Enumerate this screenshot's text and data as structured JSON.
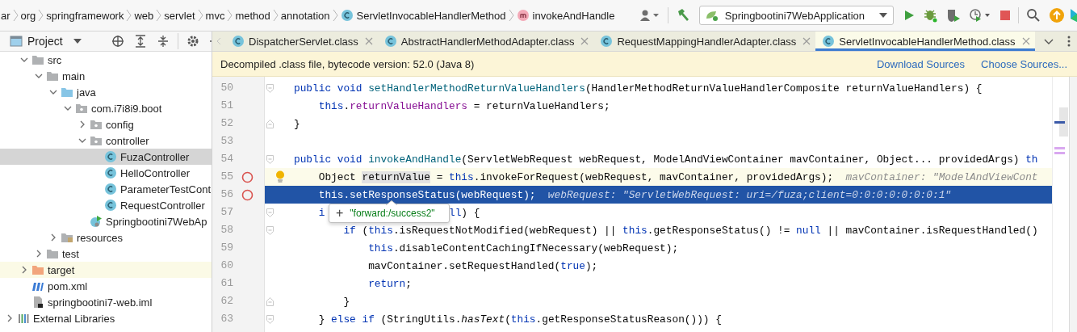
{
  "breadcrumbs": [
    {
      "text": "ar",
      "kind": "package"
    },
    {
      "text": "org",
      "kind": "package"
    },
    {
      "text": "springframework",
      "kind": "package"
    },
    {
      "text": "web",
      "kind": "package"
    },
    {
      "text": "servlet",
      "kind": "package"
    },
    {
      "text": "mvc",
      "kind": "package"
    },
    {
      "text": "method",
      "kind": "package"
    },
    {
      "text": "annotation",
      "kind": "package"
    },
    {
      "text": "ServletInvocableHandlerMethod",
      "kind": "class"
    },
    {
      "text": "invokeAndHandle",
      "kind": "method"
    }
  ],
  "run_configuration": "Springbootini7WebApplication",
  "project_panel": {
    "title": "Project"
  },
  "tree": [
    {
      "children": [
        {
          "label": "src",
          "kind": "folder",
          "expanded": true,
          "selected": false,
          "children": [
            {
              "label": "main",
              "kind": "folder",
              "expanded": true,
              "selected": false,
              "children": [
                {
                  "label": "java",
                  "kind": "source-folder",
                  "expanded": true,
                  "selected": false,
                  "children": [
                    {
                      "label": "com.i7i8i9.boot",
                      "kind": "package",
                      "expanded": true,
                      "selected": false,
                      "children": [
                        {
                          "label": "config",
                          "kind": "package",
                          "expanded": false,
                          "selected": false
                        },
                        {
                          "label": "controller",
                          "kind": "package",
                          "expanded": true,
                          "selected": false,
                          "children": [
                            {
                              "label": "FuzaController",
                              "kind": "class",
                              "selected": true
                            },
                            {
                              "label": "HelloController",
                              "kind": "class",
                              "selected": false
                            },
                            {
                              "label": "ParameterTestCont",
                              "kind": "class",
                              "selected": false
                            },
                            {
                              "label": "RequestController",
                              "kind": "class",
                              "selected": false
                            }
                          ]
                        },
                        {
                          "label": "Springbootini7WebAp",
                          "kind": "spring-app",
                          "selected": false
                        }
                      ]
                    }
                  ]
                },
                {
                  "label": "resources",
                  "kind": "resources-folder",
                  "expanded": false,
                  "selected": false
                }
              ]
            },
            {
              "label": "test",
              "kind": "folder",
              "expanded": false,
              "selected": false
            }
          ]
        },
        {
          "label": "target",
          "kind": "target-folder",
          "expanded": false,
          "selected": false
        },
        {
          "label": "pom.xml",
          "kind": "maven",
          "selected": false
        },
        {
          "label": "springbootini7-web.iml",
          "kind": "iml",
          "selected": false
        }
      ]
    },
    {
      "label": "External Libraries",
      "kind": "libraries",
      "expanded": false,
      "selected": false
    }
  ],
  "tabs": [
    {
      "label": "DispatcherServlet.class",
      "selected": false
    },
    {
      "label": "AbstractHandlerMethodAdapter.class",
      "selected": false
    },
    {
      "label": "RequestMappingHandlerAdapter.class",
      "selected": false
    },
    {
      "label": "ServletInvocableHandlerMethod.class",
      "selected": true
    }
  ],
  "banner": {
    "message": "Decompiled .class file, bytecode version: 52.0 (Java 8)",
    "links": [
      "Download Sources",
      "Choose Sources..."
    ]
  },
  "code_lines": [
    {
      "number": "50",
      "caret_line": false,
      "execution_point": false,
      "breakpoint": false,
      "intention": false,
      "fold_start": true,
      "fold_end": false,
      "tokens": [
        {
          "t": "public void ",
          "kind": "kw"
        },
        {
          "t": "setHandlerMethodReturnValueHandlers",
          "kind": "decl"
        },
        {
          "t": "(HandlerMethodReturnValueHandlerComposite returnValueHandlers) {",
          "kind": "text"
        }
      ]
    },
    {
      "number": "51",
      "caret_line": false,
      "execution_point": false,
      "breakpoint": false,
      "intention": false,
      "fold_start": false,
      "fold_end": false,
      "tokens": [
        {
          "t": "    this",
          "kind": "kw"
        },
        {
          "t": ".",
          "kind": "text"
        },
        {
          "t": "returnValueHandlers",
          "kind": "field"
        },
        {
          "t": " = returnValueHandlers;",
          "kind": "text"
        }
      ]
    },
    {
      "number": "52",
      "caret_line": false,
      "execution_point": false,
      "breakpoint": false,
      "intention": false,
      "fold_start": false,
      "fold_end": true,
      "tokens": [
        {
          "t": "}",
          "kind": "text"
        }
      ]
    },
    {
      "number": "53",
      "caret_line": false,
      "execution_point": false,
      "breakpoint": false,
      "intention": false,
      "fold_start": false,
      "fold_end": false
    },
    {
      "number": "54",
      "caret_line": false,
      "execution_point": false,
      "breakpoint": false,
      "intention": false,
      "fold_start": true,
      "fold_end": false,
      "tokens": [
        {
          "t": "public void ",
          "kind": "kw"
        },
        {
          "t": "invokeAndHandle",
          "kind": "decl"
        },
        {
          "t": "(ServletWebRequest webRequest, ModelAndViewContainer mavContainer, Object... providedArgs) ",
          "kind": "text"
        },
        {
          "t": "th",
          "kind": "kw"
        }
      ]
    },
    {
      "number": "55",
      "caret_line": true,
      "execution_point": false,
      "breakpoint": true,
      "intention": true,
      "fold_start": false,
      "fold_end": false,
      "tokens": [
        {
          "t": "    Object ",
          "kind": "text"
        },
        {
          "t": "returnValue",
          "kind": "ref"
        },
        {
          "t": " = ",
          "kind": "text"
        },
        {
          "t": "this",
          "kind": "kw"
        },
        {
          "t": ".invokeForRequest(webRequest, mavContainer, providedArgs);",
          "kind": "text"
        },
        {
          "t": "mavContainer: \"ModelAndViewCont",
          "kind": "hint"
        }
      ]
    },
    {
      "number": "56",
      "caret_line": false,
      "execution_point": true,
      "breakpoint": true,
      "intention": false,
      "fold_start": false,
      "fold_end": false,
      "tokens": [
        {
          "t": "    this.setResponseStatus(webRequest);",
          "kind": "text"
        },
        {
          "t": "webRequest: \"ServletWebRequest: uri=/fuza;client=0:0:0:0:0:0:0:1\"",
          "kind": "hint"
        }
      ]
    },
    {
      "number": "57",
      "caret_line": false,
      "execution_point": false,
      "breakpoint": false,
      "intention": false,
      "fold_start": true,
      "fold_end": false,
      "tokens": [
        {
          "t": "    i",
          "kind": "kw"
        },
        {
          "t": "ll",
          "kind": "kw",
          "after_popup": true
        },
        {
          "t": ") {",
          "kind": "text"
        }
      ]
    },
    {
      "number": "58",
      "caret_line": false,
      "execution_point": false,
      "breakpoint": false,
      "intention": false,
      "fold_start": true,
      "fold_end": false,
      "tokens": [
        {
          "t": "        if ",
          "kind": "kw"
        },
        {
          "t": "(",
          "kind": "text"
        },
        {
          "t": "this",
          "kind": "kw"
        },
        {
          "t": ".isRequestNotModified(webRequest) || ",
          "kind": "text"
        },
        {
          "t": "this",
          "kind": "kw"
        },
        {
          "t": ".getResponseStatus() != ",
          "kind": "text"
        },
        {
          "t": "null",
          "kind": "kw"
        },
        {
          "t": " || mavContainer.isRequestHandled()",
          "kind": "text"
        }
      ]
    },
    {
      "number": "59",
      "caret_line": false,
      "execution_point": false,
      "breakpoint": false,
      "intention": false,
      "fold_start": false,
      "fold_end": false,
      "tokens": [
        {
          "t": "            this",
          "kind": "kw"
        },
        {
          "t": ".disableContentCachingIfNecessary(webRequest);",
          "kind": "text"
        }
      ]
    },
    {
      "number": "60",
      "caret_line": false,
      "execution_point": false,
      "breakpoint": false,
      "intention": false,
      "fold_start": false,
      "fold_end": false,
      "tokens": [
        {
          "t": "            mavContainer.setRequestHandled(",
          "kind": "text"
        },
        {
          "t": "true",
          "kind": "kw"
        },
        {
          "t": ");",
          "kind": "text"
        }
      ]
    },
    {
      "number": "61",
      "caret_line": false,
      "execution_point": false,
      "breakpoint": false,
      "intention": false,
      "fold_start": false,
      "fold_end": false,
      "tokens": [
        {
          "t": "            return",
          "kind": "kw"
        },
        {
          "t": ";",
          "kind": "text"
        }
      ]
    },
    {
      "number": "62",
      "caret_line": false,
      "execution_point": false,
      "breakpoint": false,
      "intention": false,
      "fold_start": false,
      "fold_end": true,
      "tokens": [
        {
          "t": "        }",
          "kind": "text"
        }
      ]
    },
    {
      "number": "63",
      "caret_line": false,
      "execution_point": false,
      "breakpoint": false,
      "intention": false,
      "fold_start": true,
      "fold_end": false,
      "tokens": [
        {
          "t": "    } ",
          "kind": "text"
        },
        {
          "t": "else if ",
          "kind": "kw"
        },
        {
          "t": "(StringUtils.",
          "kind": "text"
        },
        {
          "t": "hasText",
          "kind": "static"
        },
        {
          "t": "(",
          "kind": "text"
        },
        {
          "t": "this",
          "kind": "kw"
        },
        {
          "t": ".getResponseStatusReason())) {",
          "kind": "text"
        }
      ]
    }
  ],
  "value_popup": {
    "expand": "+",
    "value": "\"forward:/success2\""
  }
}
